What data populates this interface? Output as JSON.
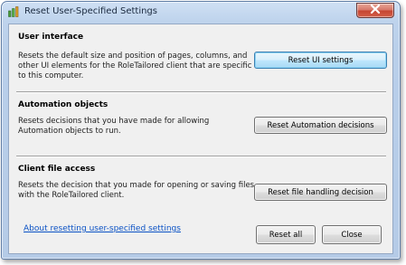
{
  "window": {
    "title": "Reset User-Specified Settings"
  },
  "sections": [
    {
      "title": "User interface",
      "description": "Resets the default size and position of pages, columns, and other UI elements for the RoleTailored client that are specific to this computer.",
      "button_label": "Reset UI settings"
    },
    {
      "title": "Automation objects",
      "description": "Resets decisions that you have made for allowing Automation objects to run.",
      "button_label": "Reset Automation decisions"
    },
    {
      "title": "Client file access",
      "description": "Resets the decision that you made for opening or saving files with the RoleTailored client.",
      "button_label": "Reset file handling decision"
    }
  ],
  "footer": {
    "help_link": "About resetting user-specified settings",
    "reset_all_label": "Reset all",
    "close_label": "Close"
  },
  "icons": {
    "app": "settings-app-icon",
    "close": "close-icon"
  },
  "colors": {
    "link": "#0b52c5",
    "close_button": "#c64633",
    "default_button_border": "#3c7fb1"
  }
}
